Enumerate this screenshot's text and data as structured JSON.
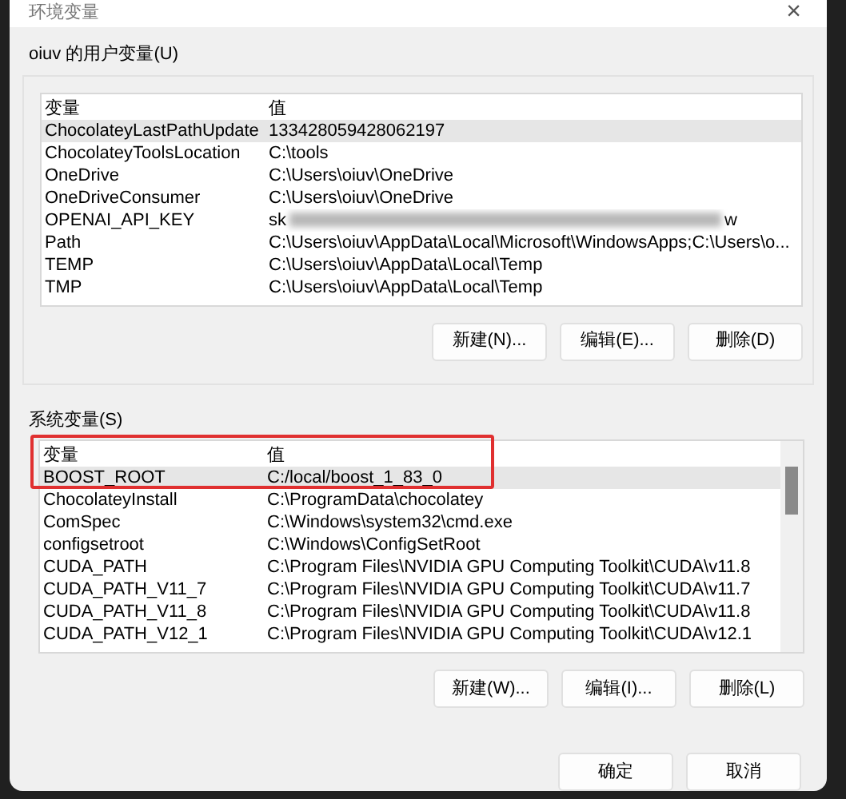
{
  "window": {
    "title": "环境变量",
    "close": "×"
  },
  "user_variables": {
    "label": "oiuv 的用户变量(U)",
    "columns": [
      "变量",
      "值"
    ],
    "rows": [
      {
        "name": "ChocolateyLastPathUpdate",
        "value": "133428059428062197",
        "selected": true
      },
      {
        "name": "ChocolateyToolsLocation",
        "value": "C:\\tools",
        "selected": false
      },
      {
        "name": "OneDrive",
        "value": "C:\\Users\\oiuv\\OneDrive",
        "selected": false
      },
      {
        "name": "OneDriveConsumer",
        "value": "C:\\Users\\oiuv\\OneDrive",
        "selected": false
      },
      {
        "name": "OPENAI_API_KEY",
        "value": "sk",
        "redacted": true,
        "value_end": "w",
        "selected": false
      },
      {
        "name": "Path",
        "value": "C:\\Users\\oiuv\\AppData\\Local\\Microsoft\\WindowsApps;C:\\Users\\o...",
        "selected": false
      },
      {
        "name": "TEMP",
        "value": "C:\\Users\\oiuv\\AppData\\Local\\Temp",
        "selected": false
      },
      {
        "name": "TMP",
        "value": "C:\\Users\\oiuv\\AppData\\Local\\Temp",
        "selected": false
      }
    ],
    "buttons": [
      "新建(N)...",
      "编辑(E)...",
      "删除(D)"
    ]
  },
  "system_variables": {
    "label": "系统变量(S)",
    "columns": [
      "变量",
      "值"
    ],
    "highlight_frame": true,
    "rows": [
      {
        "name": "BOOST_ROOT",
        "value": "C:/local/boost_1_83_0",
        "selected": true
      },
      {
        "name": "ChocolateyInstall",
        "value": "C:\\ProgramData\\chocolatey",
        "selected": false
      },
      {
        "name": "ComSpec",
        "value": "C:\\Windows\\system32\\cmd.exe",
        "selected": false
      },
      {
        "name": "configsetroot",
        "value": "C:\\Windows\\ConfigSetRoot",
        "selected": false
      },
      {
        "name": "CUDA_PATH",
        "value": "C:\\Program Files\\NVIDIA GPU Computing Toolkit\\CUDA\\v11.8",
        "selected": false
      },
      {
        "name": "CUDA_PATH_V11_7",
        "value": "C:\\Program Files\\NVIDIA GPU Computing Toolkit\\CUDA\\v11.7",
        "selected": false
      },
      {
        "name": "CUDA_PATH_V11_8",
        "value": "C:\\Program Files\\NVIDIA GPU Computing Toolkit\\CUDA\\v11.8",
        "selected": false
      },
      {
        "name": "CUDA_PATH_V12_1",
        "value": "C:\\Program Files\\NVIDIA GPU Computing Toolkit\\CUDA\\v12.1",
        "selected": false
      }
    ],
    "buttons": [
      "新建(W)...",
      "编辑(I)...",
      "删除(L)"
    ]
  },
  "dialog_buttons": [
    "确定",
    "取消"
  ]
}
